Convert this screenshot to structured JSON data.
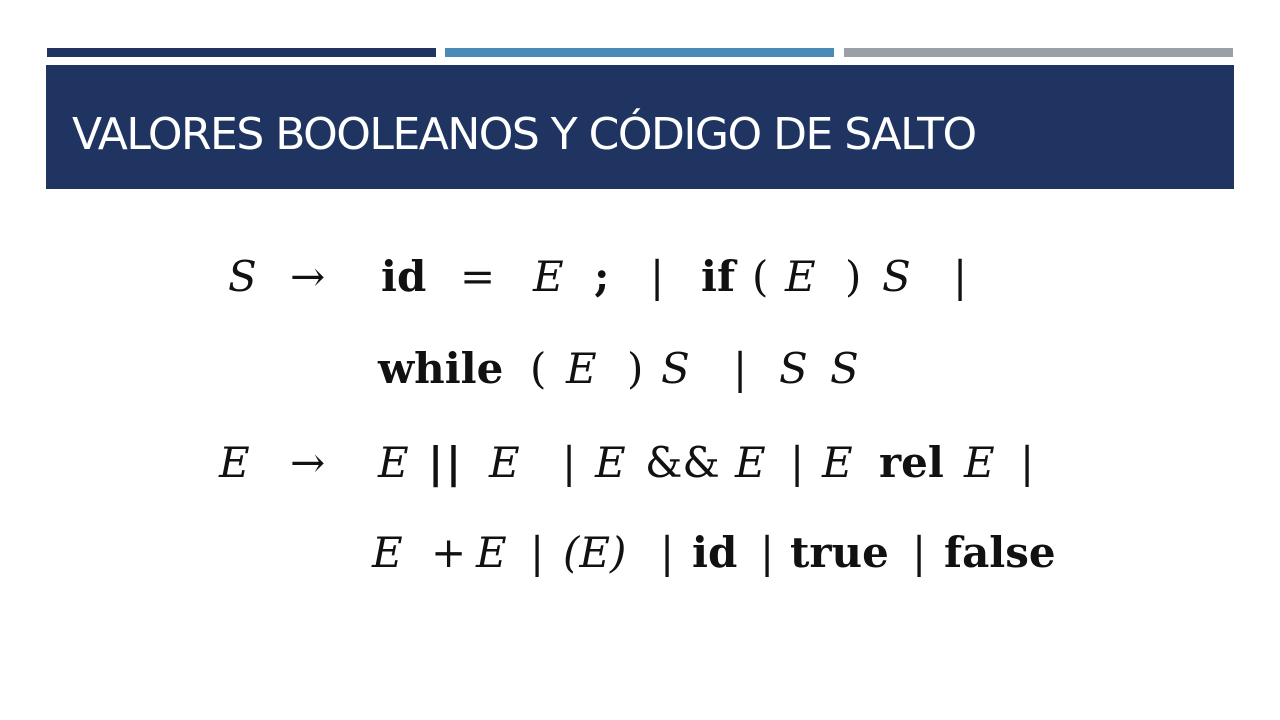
{
  "slide": {
    "title": "VALORES BOOLEANOS Y CÓDIGO DE SALTO"
  },
  "colors": {
    "navy": "#1f3461",
    "blue": "#4a8ab8",
    "gray": "#9aa0a6",
    "text": "#111111",
    "background": "#ffffff"
  },
  "grammar": {
    "line1": {
      "lhs": "S",
      "arrow": "→",
      "tokens": [
        "id",
        "=",
        "E",
        ";",
        "|",
        "if",
        "(",
        "E",
        ")",
        "S",
        "|"
      ]
    },
    "line2": {
      "tokens": [
        "while",
        "(",
        "E",
        ")",
        "S",
        "|",
        "S",
        "S"
      ]
    },
    "line3": {
      "lhs": "E",
      "arrow": "→",
      "tokens": [
        "E",
        "| |",
        "E",
        "|",
        "E",
        "&&",
        "E",
        "|",
        "E",
        "rel",
        "E",
        "|"
      ]
    },
    "line4": {
      "tokens": [
        "E",
        "+",
        "E",
        "|",
        "(E)",
        "|",
        "id",
        "|",
        "true",
        "|",
        "false"
      ]
    }
  }
}
